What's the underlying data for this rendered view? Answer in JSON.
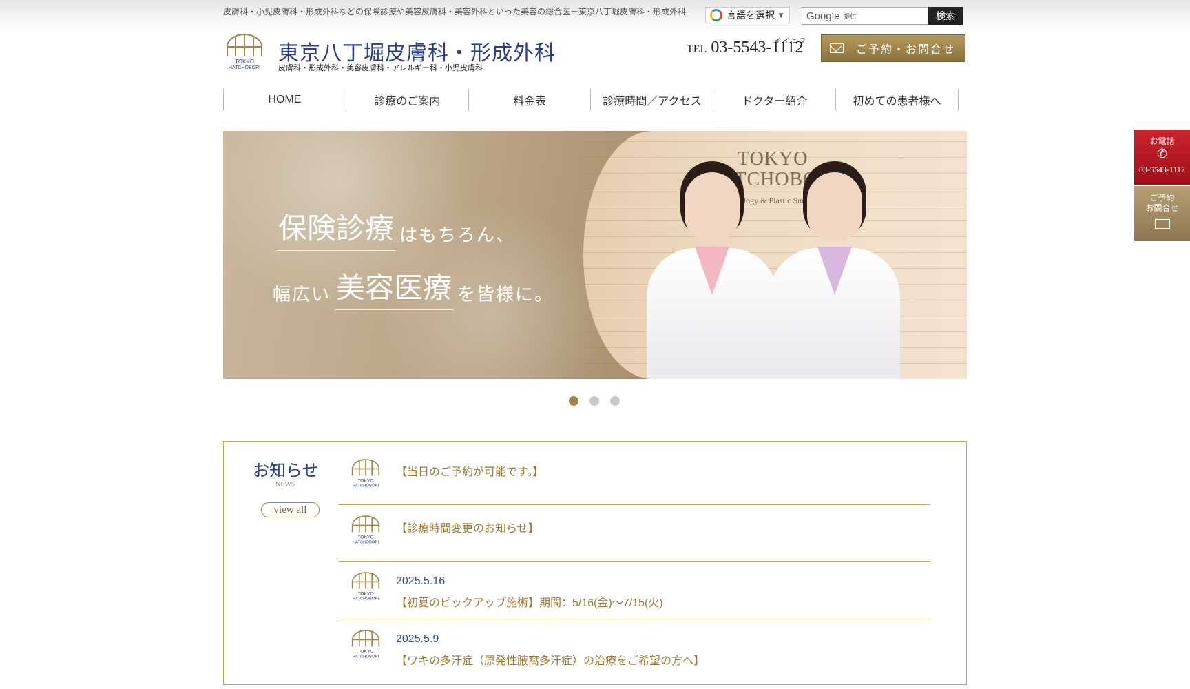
{
  "header": {
    "tagline": "皮膚科・小児皮膚科・形成外科などの保険診療や美容皮膚科・美容外科といった美容の総合医－東京八丁堀皮膚科・形成外科",
    "translate_label": "言語を選択",
    "translate_caret": "▼",
    "search_brand": "Google",
    "search_provided": "提供",
    "search_button": "検索",
    "site_title": "東京八丁堀皮膚科・形成外科",
    "site_subtitle": "皮膚科・形成外科・美容皮膚科・アレルギー科・小児皮膚科",
    "logo_text": "TOKYO HATCHOBORI",
    "tel_label": "TEL",
    "tel_number": "03-5543-1112",
    "tel_ruby": "イイヒフ",
    "contact_button": "ご予約・お問合せ"
  },
  "nav": [
    {
      "label": "HOME"
    },
    {
      "label": "診療のご案内"
    },
    {
      "label": "料金表"
    },
    {
      "label": "診療時間／アクセス"
    },
    {
      "label": "ドクター紹介"
    },
    {
      "label": "初めての患者様へ"
    }
  ],
  "hero": {
    "line1_big": "保険診療",
    "line1_small": "はもちろん、",
    "line2_pre": "幅広い",
    "line2_big": "美容医療",
    "line2_post": "を皆様に。",
    "wall_logo_1": "TOKYO",
    "wall_logo_2": "HATCHOBORI",
    "wall_logo_sub": "tology & Plastic Surg"
  },
  "slider": {
    "count": 3,
    "active": 0
  },
  "news": {
    "title": "お知らせ",
    "title_en": "NEWS",
    "view_all": "view all",
    "items": [
      {
        "date": "",
        "title": "【当日のご予約が可能です。】"
      },
      {
        "date": "",
        "title": "【診療時間変更のお知らせ】"
      },
      {
        "date": "2025.5.16",
        "title": "【初夏のピックアップ施術】期間：5/16(金)～7/15(火)"
      },
      {
        "date": "2025.5.9",
        "title": "【ワキの多汗症（原発性腋窩多汗症）の治療をご希望の方へ】"
      }
    ]
  },
  "side_buttons": {
    "phone_label": "お電話",
    "phone_number": "03-5543-1112",
    "reserve_label1": "ご予約",
    "reserve_label2": "お問合せ"
  },
  "colors": {
    "brand_blue": "#2a3f8f",
    "gold": "#a28448",
    "red": "#b3121d",
    "olive": "#b8ad5a"
  }
}
